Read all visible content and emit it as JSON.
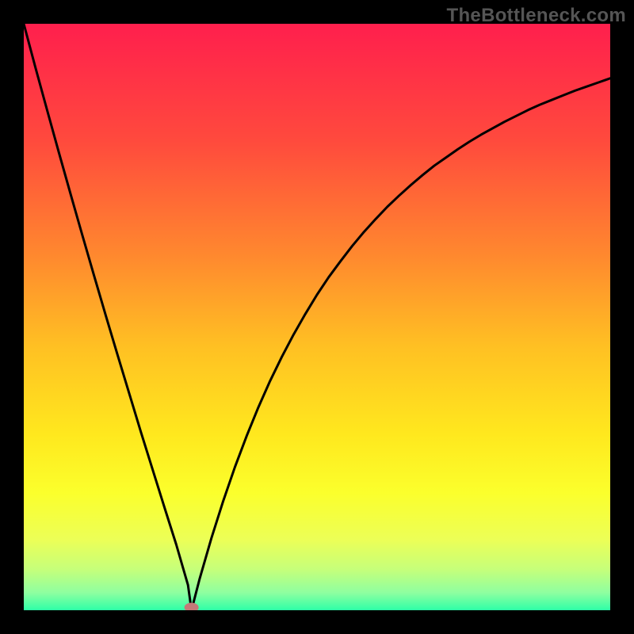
{
  "watermark": "TheBottleneck.com",
  "chart_data": {
    "type": "line",
    "title": "",
    "subtitle": "",
    "xlabel": "",
    "ylabel": "",
    "xlim": [
      0,
      1
    ],
    "ylim": [
      0,
      1
    ],
    "grid": false,
    "background_gradient_stops": [
      {
        "offset": 0.0,
        "color": "#ff1f4d"
      },
      {
        "offset": 0.2,
        "color": "#ff4a3d"
      },
      {
        "offset": 0.4,
        "color": "#ff8a2e"
      },
      {
        "offset": 0.55,
        "color": "#ffc023"
      },
      {
        "offset": 0.7,
        "color": "#ffe81e"
      },
      {
        "offset": 0.8,
        "color": "#fbff2c"
      },
      {
        "offset": 0.88,
        "color": "#ecff57"
      },
      {
        "offset": 0.93,
        "color": "#c6ff7a"
      },
      {
        "offset": 0.97,
        "color": "#8fffa0"
      },
      {
        "offset": 1.0,
        "color": "#2effa7"
      }
    ],
    "marker": {
      "x": 0.286,
      "y": 0.002,
      "color": "#c47a78"
    },
    "series": [
      {
        "name": "curve",
        "x": [
          0.0,
          0.02,
          0.04,
          0.06,
          0.08,
          0.1,
          0.12,
          0.14,
          0.16,
          0.18,
          0.2,
          0.22,
          0.24,
          0.26,
          0.28,
          0.286,
          0.3,
          0.32,
          0.34,
          0.36,
          0.38,
          0.4,
          0.42,
          0.44,
          0.46,
          0.48,
          0.5,
          0.52,
          0.54,
          0.56,
          0.58,
          0.6,
          0.62,
          0.64,
          0.66,
          0.68,
          0.7,
          0.72,
          0.74,
          0.76,
          0.78,
          0.8,
          0.82,
          0.84,
          0.86,
          0.88,
          0.9,
          0.92,
          0.94,
          0.96,
          0.98,
          1.0
        ],
        "y": [
          1.0,
          0.925,
          0.852,
          0.78,
          0.709,
          0.639,
          0.57,
          0.502,
          0.435,
          0.369,
          0.303,
          0.239,
          0.175,
          0.112,
          0.043,
          0.0,
          0.054,
          0.123,
          0.186,
          0.244,
          0.297,
          0.346,
          0.391,
          0.432,
          0.47,
          0.505,
          0.538,
          0.568,
          0.595,
          0.621,
          0.645,
          0.667,
          0.688,
          0.707,
          0.725,
          0.742,
          0.758,
          0.772,
          0.786,
          0.799,
          0.811,
          0.822,
          0.833,
          0.843,
          0.853,
          0.862,
          0.87,
          0.878,
          0.886,
          0.893,
          0.9,
          0.907
        ]
      }
    ]
  }
}
